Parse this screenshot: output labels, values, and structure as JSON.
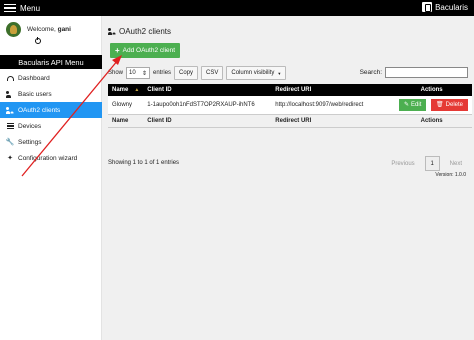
{
  "topbar": {
    "menu_label": "Menu",
    "brand": "Bacularis"
  },
  "sidebar": {
    "welcome_prefix": "Welcome,",
    "username": "gani",
    "api_menu_title": "Bacularis API Menu",
    "items": [
      {
        "label": "Dashboard",
        "icon": "dashboard-icon",
        "active": false
      },
      {
        "label": "Basic users",
        "icon": "users-icon",
        "active": false
      },
      {
        "label": "OAuth2 clients",
        "icon": "oauth2-clients-icon",
        "active": true
      },
      {
        "label": "Devices",
        "icon": "devices-icon",
        "active": false
      },
      {
        "label": "Settings",
        "icon": "wrench-icon",
        "active": false
      },
      {
        "label": "Configuration wizard",
        "icon": "wand-icon",
        "active": false
      }
    ]
  },
  "main": {
    "title": "OAuth2 clients",
    "add_button": "Add OAuth2 client",
    "show_prefix": "Show",
    "page_length": "10",
    "show_suffix": "entries",
    "copy_button": "Copy",
    "csv_button": "CSV",
    "column_visibility": "Column visibility",
    "search_label": "Search:",
    "search_value": ""
  },
  "table": {
    "headers": [
      "Name",
      "Client ID",
      "Redirect URI",
      "Actions"
    ],
    "rows": [
      {
        "name": "Glowny",
        "client_id": "1-1aupo0oh1nFdST7OP2RXAUP-ihNT6",
        "redirect_uri": "http://localhost:9097/web/redirect",
        "edit": "Edit",
        "delete": "Delete"
      }
    ]
  },
  "footer": {
    "info": "Showing 1 to 1 of 1 entries",
    "prev": "Previous",
    "page": "1",
    "next": "Next",
    "version": "Version: 1.0.0"
  },
  "colors": {
    "active": "#2196f3",
    "success": "#4caf50",
    "danger": "#e53935",
    "annotation": "#e02020"
  }
}
